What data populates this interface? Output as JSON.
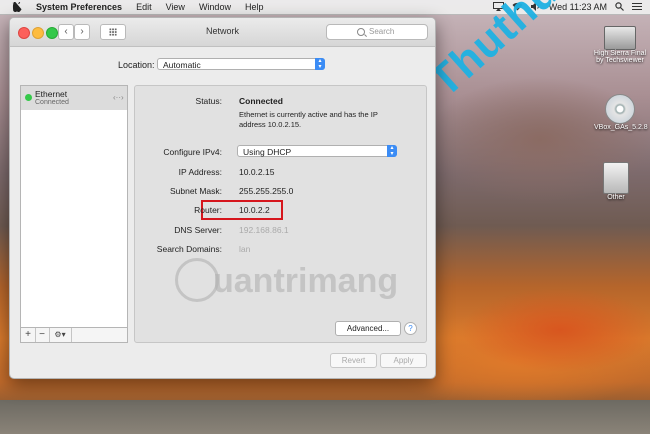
{
  "menubar": {
    "app_name": "System Preferences",
    "menus": [
      "Edit",
      "View",
      "Window",
      "Help"
    ],
    "clock": "Wed 11:23 AM"
  },
  "desktop": {
    "icons": [
      {
        "label": "High Sierra Final by Techsviewer",
        "icon": "hard-drive-icon"
      },
      {
        "label": "VBox_GAs_5.2.8",
        "icon": "dvd-icon"
      },
      {
        "label": "Other",
        "icon": "disk-image-icon"
      }
    ],
    "watermark_top": "Thuthuattin",
    "watermark_center": "uantrimang"
  },
  "window": {
    "title": "Network",
    "search_placeholder": "Search",
    "location_label": "Location:",
    "location_value": "Automatic"
  },
  "sidebar": {
    "services": [
      {
        "name": "Ethernet",
        "status": "Connected",
        "status_color": "#35c94a"
      }
    ],
    "add": "+",
    "remove": "−",
    "gear": "⚙︎▾"
  },
  "details": {
    "status_label": "Status:",
    "status_value": "Connected",
    "status_desc": "Ethernet is currently active and has the IP address 10.0.2.15.",
    "configure_label": "Configure IPv4:",
    "configure_value": "Using DHCP",
    "ip_label": "IP Address:",
    "ip_value": "10.0.2.15",
    "subnet_label": "Subnet Mask:",
    "subnet_value": "255.255.255.0",
    "router_label": "Router:",
    "router_value": "10.0.2.2",
    "dns_label": "DNS Server:",
    "dns_value": "192.168.86.1",
    "search_domains_label": "Search Domains:",
    "search_domains_value": "lan",
    "advanced_button": "Advanced...",
    "help_button": "?"
  },
  "footer": {
    "revert": "Revert",
    "apply": "Apply"
  },
  "colors": {
    "highlight_box": "#d6161d",
    "accent": "#3b8cf5",
    "connected": "#35c94a"
  }
}
